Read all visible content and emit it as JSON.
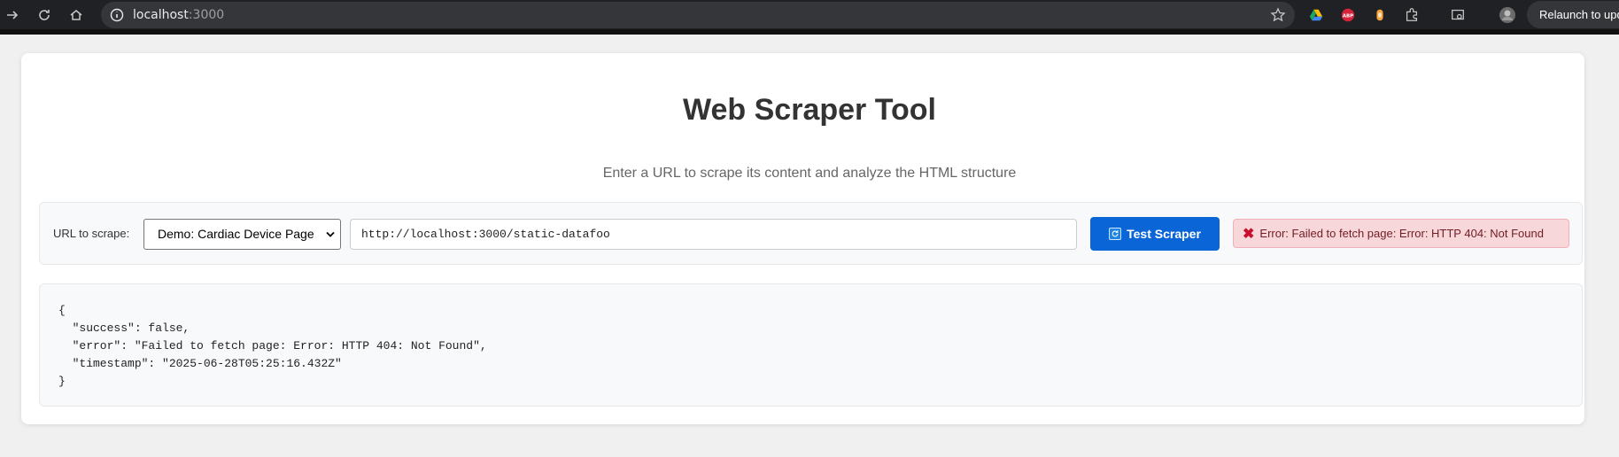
{
  "browser": {
    "url_host": "localhost",
    "url_port": ":3000",
    "relaunch_label": "Relaunch to update"
  },
  "page": {
    "title": "Web Scraper Tool",
    "subtitle": "Enter a URL to scrape its content and analyze the HTML structure"
  },
  "form": {
    "label": "URL to scrape:",
    "selected_option": "Demo: Cardiac Device Page",
    "url_value": "http://localhost:3000/static-datafoo",
    "button_label": "Test Scraper",
    "button_icon": "refresh-icon",
    "error_text": "Error: Failed to fetch page: Error: HTTP 404: Not Found",
    "error_icon": "error-x-icon"
  },
  "result": {
    "json_text": "{\n  \"success\": false,\n  \"error\": \"Failed to fetch page: Error: HTTP 404: Not Found\",\n  \"timestamp\": \"2025-06-28T05:25:16.432Z\"\n}"
  },
  "colors": {
    "primary_button": "#0a66d6",
    "error_bg": "#f8d7da",
    "error_text": "#721c24"
  }
}
